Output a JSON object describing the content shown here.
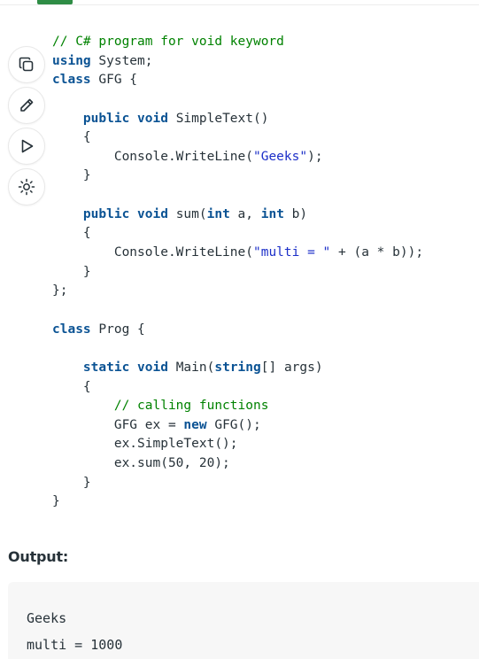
{
  "toolbar": {
    "copy_icon": "copy-icon",
    "edit_icon": "pencil-icon",
    "run_icon": "play-icon",
    "theme_icon": "sun-icon"
  },
  "code": {
    "language": "C#",
    "lines": [
      [
        {
          "t": "// C# program for void keyword",
          "c": "cm"
        }
      ],
      [
        {
          "t": "using",
          "c": "kw"
        },
        {
          "t": " System;",
          "c": ""
        }
      ],
      [
        {
          "t": "class",
          "c": "kw"
        },
        {
          "t": " GFG {",
          "c": ""
        }
      ],
      [],
      [
        {
          "t": "    ",
          "c": ""
        },
        {
          "t": "public",
          "c": "kw"
        },
        {
          "t": " ",
          "c": ""
        },
        {
          "t": "void",
          "c": "kw"
        },
        {
          "t": " SimpleText()",
          "c": ""
        }
      ],
      [
        {
          "t": "    {",
          "c": ""
        }
      ],
      [
        {
          "t": "        Console.WriteLine(",
          "c": ""
        },
        {
          "t": "\"Geeks\"",
          "c": "st"
        },
        {
          "t": ");",
          "c": ""
        }
      ],
      [
        {
          "t": "    }",
          "c": ""
        }
      ],
      [],
      [
        {
          "t": "    ",
          "c": ""
        },
        {
          "t": "public",
          "c": "kw"
        },
        {
          "t": " ",
          "c": ""
        },
        {
          "t": "void",
          "c": "kw"
        },
        {
          "t": " sum(",
          "c": ""
        },
        {
          "t": "int",
          "c": "kw"
        },
        {
          "t": " a, ",
          "c": ""
        },
        {
          "t": "int",
          "c": "kw"
        },
        {
          "t": " b)",
          "c": ""
        }
      ],
      [
        {
          "t": "    {",
          "c": ""
        }
      ],
      [
        {
          "t": "        Console.WriteLine(",
          "c": ""
        },
        {
          "t": "\"multi = \"",
          "c": "st"
        },
        {
          "t": " + (a * b));",
          "c": ""
        }
      ],
      [
        {
          "t": "    }",
          "c": ""
        }
      ],
      [
        {
          "t": "};",
          "c": ""
        }
      ],
      [],
      [
        {
          "t": "class",
          "c": "kw"
        },
        {
          "t": " Prog {",
          "c": ""
        }
      ],
      [],
      [
        {
          "t": "    ",
          "c": ""
        },
        {
          "t": "static",
          "c": "kw"
        },
        {
          "t": " ",
          "c": ""
        },
        {
          "t": "void",
          "c": "kw"
        },
        {
          "t": " Main(",
          "c": ""
        },
        {
          "t": "string",
          "c": "kw"
        },
        {
          "t": "[] args)",
          "c": ""
        }
      ],
      [
        {
          "t": "    {",
          "c": ""
        }
      ],
      [
        {
          "t": "        ",
          "c": ""
        },
        {
          "t": "// calling functions",
          "c": "cm"
        }
      ],
      [
        {
          "t": "        GFG ex = ",
          "c": ""
        },
        {
          "t": "new",
          "c": "kw"
        },
        {
          "t": " GFG();",
          "c": ""
        }
      ],
      [
        {
          "t": "        ex.SimpleText();",
          "c": ""
        }
      ],
      [
        {
          "t": "        ex.sum(50, 20);",
          "c": ""
        }
      ],
      [
        {
          "t": "    }",
          "c": ""
        }
      ],
      [
        {
          "t": "}",
          "c": ""
        }
      ]
    ]
  },
  "output": {
    "heading": "Output:",
    "text": "Geeks\nmulti = 1000"
  },
  "colors": {
    "keyword": "#0b5394",
    "comment": "#008200",
    "string": "#1c2fc8",
    "text": "#273239",
    "accent": "#2f8d46",
    "output_bg": "#f7f7f7"
  }
}
